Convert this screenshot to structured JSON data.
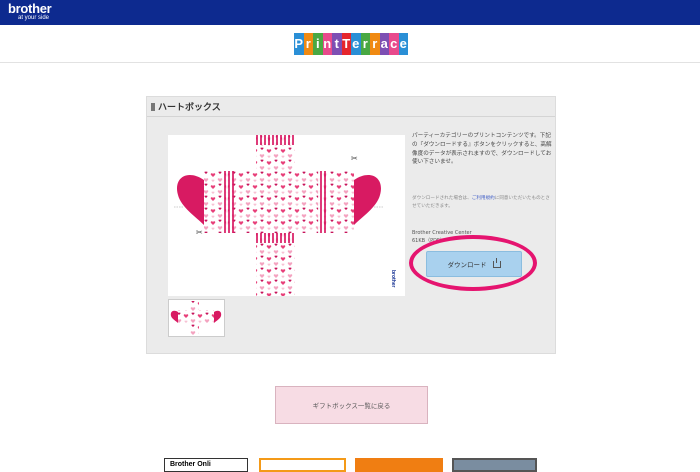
{
  "header": {
    "brand_name": "brother",
    "brand_tagline": "at your side",
    "bar_color": "#0d2a8f"
  },
  "site_logo": {
    "text": "PrintTerrace",
    "letters": [
      {
        "ch": "P",
        "color": "#2a8fd6"
      },
      {
        "ch": "r",
        "color": "#f08a12"
      },
      {
        "ch": "i",
        "color": "#49a843"
      },
      {
        "ch": "n",
        "color": "#e84a8c"
      },
      {
        "ch": "t",
        "color": "#7d4fb3"
      },
      {
        "ch": "T",
        "color": "#e5262d"
      },
      {
        "ch": "e",
        "color": "#2a8fd6"
      },
      {
        "ch": "r",
        "color": "#49a843"
      },
      {
        "ch": "r",
        "color": "#f08a12"
      },
      {
        "ch": "a",
        "color": "#7d4fb3"
      },
      {
        "ch": "c",
        "color": "#e84a8c"
      },
      {
        "ch": "e",
        "color": "#2a8fd6"
      }
    ]
  },
  "content": {
    "title": "ハートボックス",
    "description": "パーティーカテゴリーのプリントコンテンツです。下記の『ダウンロードする』ボタンをクリックすると、高解像度のデータが表示されますので、ダウンロードしてお使い下さいませ。",
    "note_before_link": "ダウンロードされた場合は、",
    "note_link": "ご利用規約",
    "note_after_link": "に同意いただいたものとさせていただきます。",
    "creator": "Brother Creative Center",
    "file_info": "61KB（PDF）",
    "download_label": "ダウンロード",
    "preview_brand": "brother",
    "highlight_color": "#e5146f"
  },
  "back_button": {
    "label": "ギフトボックス一覧に戻る"
  },
  "footer_banners": [
    {
      "text": "Brother Onli"
    }
  ]
}
